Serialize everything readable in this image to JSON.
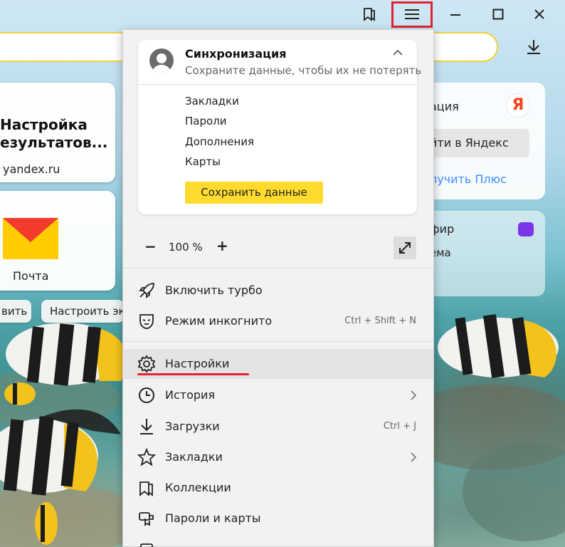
{
  "left_cards": {
    "settings_card": {
      "title_line1": "Настройка",
      "title_line2": "езультатов...",
      "domain": "yandex.ru"
    },
    "mail_card": {
      "label": "Почта"
    },
    "pill_left": "вить",
    "pill_customize": "Настроить эк"
  },
  "right_cards": {
    "account": {
      "partial_title": "ация",
      "login_label": "йти в Яндекс",
      "plus_link": "лучить Плюс",
      "logo_letter": "Я"
    },
    "ether": {
      "partial_title": "фир",
      "partial_sub": "ема"
    }
  },
  "menu": {
    "sync": {
      "title": "Синхронизация",
      "subtitle": "Сохраните данные, чтобы их не потерять",
      "items": [
        "Закладки",
        "Пароли",
        "Дополнения",
        "Карты"
      ],
      "button": "Сохранить данные"
    },
    "zoom": {
      "minus": "−",
      "value": "100 %",
      "plus": "+"
    },
    "items": [
      {
        "label": "Включить турбо",
        "shortcut": ""
      },
      {
        "label": "Режим инкогнито",
        "shortcut": "Ctrl + Shift + N"
      },
      {
        "label": "Настройки",
        "shortcut": ""
      },
      {
        "label": "История",
        "shortcut": ""
      },
      {
        "label": "Загрузки",
        "shortcut": "Ctrl + J"
      },
      {
        "label": "Закладки",
        "shortcut": ""
      },
      {
        "label": "Коллекции",
        "shortcut": ""
      },
      {
        "label": "Пароли и карты",
        "shortcut": ""
      }
    ]
  },
  "colors": {
    "accent_yellow": "#ffdb2e",
    "highlight_red": "#e0242f",
    "yandex_red": "#fc3f1d",
    "ether_purple": "#7b35e8"
  }
}
